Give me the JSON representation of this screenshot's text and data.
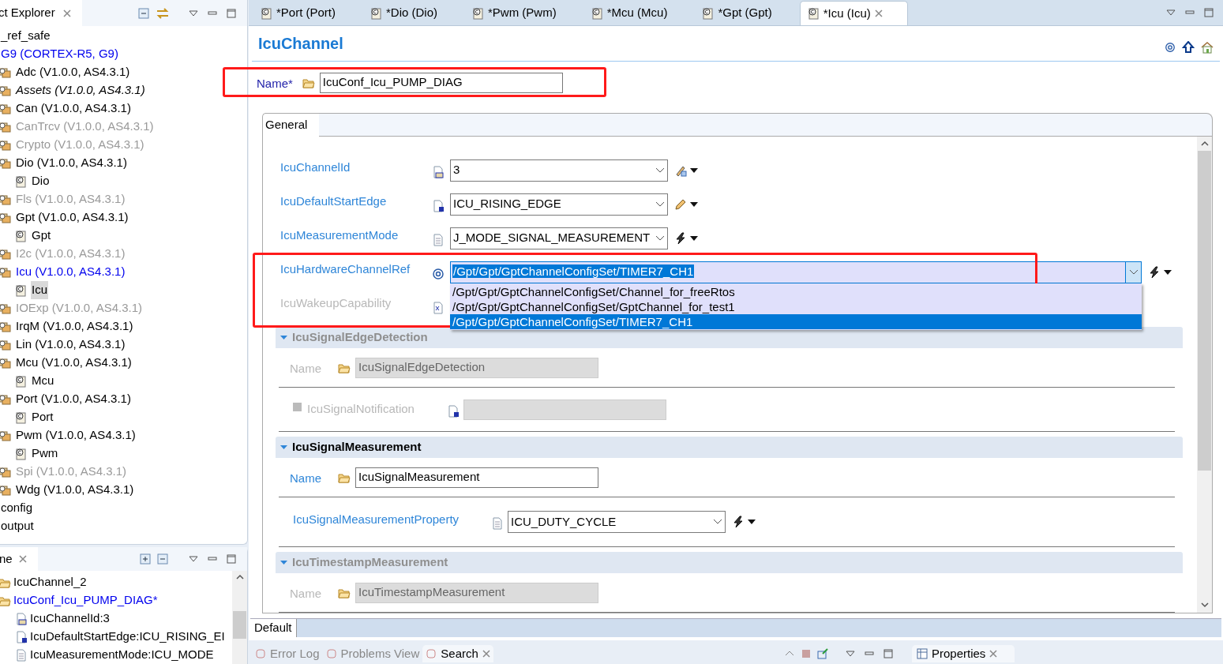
{
  "explorer": {
    "title": "ct Explorer",
    "items": [
      {
        "label": "_ref_safe",
        "kind": "normal",
        "selected": false
      },
      {
        "label": "G9 (CORTEX-R5, G9)",
        "kind": "active",
        "selected": false,
        "children": [
          {
            "label": "Adc (V1.0.0, AS4.3.1)",
            "kind": "normal",
            "selected": false
          },
          {
            "label": "Assets (V1.0.0, AS4.3.1)",
            "kind": "italic",
            "selected": false
          },
          {
            "label": "Can (V1.0.0, AS4.3.1)",
            "kind": "normal",
            "selected": false
          },
          {
            "label": "CanTrcv (V1.0.0, AS4.3.1)",
            "kind": "disabled",
            "selected": false
          },
          {
            "label": "Crypto (V1.0.0, AS4.3.1)",
            "kind": "disabled",
            "selected": false
          },
          {
            "label": "Dio (V1.0.0, AS4.3.1)",
            "kind": "normal",
            "selected": false,
            "children": [
              {
                "label": "Dio",
                "kind": "normal",
                "selected": false
              }
            ]
          },
          {
            "label": "Fls (V1.0.0, AS4.3.1)",
            "kind": "disabled",
            "selected": false
          },
          {
            "label": "Gpt (V1.0.0, AS4.3.1)",
            "kind": "normal",
            "selected": false,
            "children": [
              {
                "label": "Gpt",
                "kind": "normal",
                "selected": false
              }
            ]
          },
          {
            "label": "I2c (V1.0.0, AS4.3.1)",
            "kind": "disabled",
            "selected": false
          },
          {
            "label": "Icu (V1.0.0, AS4.3.1)",
            "kind": "active",
            "selected": false,
            "children": [
              {
                "label": "Icu",
                "kind": "normal",
                "selected": true
              }
            ]
          },
          {
            "label": "IOExp (V1.0.0, AS4.3.1)",
            "kind": "disabled",
            "selected": false
          },
          {
            "label": "IrqM (V1.0.0, AS4.3.1)",
            "kind": "normal",
            "selected": false
          },
          {
            "label": "Lin (V1.0.0, AS4.3.1)",
            "kind": "normal",
            "selected": false
          },
          {
            "label": "Mcu (V1.0.0, AS4.3.1)",
            "kind": "normal",
            "selected": false,
            "children": [
              {
                "label": "Mcu",
                "kind": "normal",
                "selected": false
              }
            ]
          },
          {
            "label": "Port (V1.0.0, AS4.3.1)",
            "kind": "normal",
            "selected": false,
            "children": [
              {
                "label": "Port",
                "kind": "normal",
                "selected": false
              }
            ]
          },
          {
            "label": "Pwm (V1.0.0, AS4.3.1)",
            "kind": "normal",
            "selected": false,
            "children": [
              {
                "label": "Pwm",
                "kind": "normal",
                "selected": false
              }
            ]
          },
          {
            "label": "Spi (V1.0.0, AS4.3.1)",
            "kind": "disabled",
            "selected": false
          },
          {
            "label": "Wdg (V1.0.0, AS4.3.1)",
            "kind": "normal",
            "selected": false
          }
        ]
      },
      {
        "label": "config",
        "kind": "normal",
        "selected": false
      },
      {
        "label": "output",
        "kind": "normal",
        "selected": false
      }
    ]
  },
  "outline": {
    "title": "ne",
    "items": [
      {
        "label": "IcuChannel_2",
        "kind": "container",
        "active": false
      },
      {
        "label": "IcuConf_Icu_PUMP_DIAG*",
        "kind": "container",
        "active": true,
        "children": [
          {
            "label": "IcuChannelId:3",
            "kind": "integer",
            "active": false
          },
          {
            "label": "IcuDefaultStartEdge:ICU_RISING_EI",
            "kind": "enum_d",
            "active": false
          },
          {
            "label": "IcuMeasurementMode:ICU_MODE",
            "kind": "enum",
            "active": false
          }
        ]
      }
    ]
  },
  "editor": {
    "tabs": [
      {
        "label": "*Port (Port)",
        "selected": false
      },
      {
        "label": "*Dio (Dio)",
        "selected": false
      },
      {
        "label": "*Pwm (Pwm)",
        "selected": false
      },
      {
        "label": "*Mcu (Mcu)",
        "selected": false
      },
      {
        "label": "*Gpt (Gpt)",
        "selected": false
      },
      {
        "label": "*Icu (Icu)",
        "selected": true
      }
    ],
    "title": "IcuChannel",
    "name": {
      "label": "Name*",
      "value": "IcuConf_Icu_PUMP_DIAG"
    },
    "form_tab": "General",
    "params": [
      {
        "label": "IcuChannelId",
        "kind": "integer",
        "value": "3",
        "disabled": false
      },
      {
        "label": "IcuDefaultStartEdge",
        "kind": "enum_d",
        "value": "ICU_RISING_EDGE",
        "disabled": false
      },
      {
        "label": "IcuMeasurementMode",
        "kind": "enum",
        "value": "J_MODE_SIGNAL_MEASUREMENT",
        "disabled": false
      },
      {
        "label": "IcuHardwareChannelRef",
        "kind": "reference",
        "value": "/Gpt/Gpt/GptChannelConfigSet/TIMER7_CH1",
        "disabled": false,
        "expanded": true,
        "options": [
          {
            "label": "/Gpt/Gpt/GptChannelConfigSet/Channel_for_freeRtos",
            "selected": false
          },
          {
            "label": "/Gpt/Gpt/GptChannelConfigSet/GptChannel_for_test1",
            "selected": false
          },
          {
            "label": "/Gpt/Gpt/GptChannelConfigSet/TIMER7_CH1",
            "selected": true
          }
        ]
      },
      {
        "label": "IcuWakeupCapability",
        "kind": "boolean",
        "disabled": true
      }
    ],
    "sections": [
      {
        "title": "IcuSignalEdgeDetection",
        "disabled": true,
        "expanded": true,
        "rows": [
          {
            "kind": "name",
            "label": "Name",
            "value": "IcuSignalEdgeDetection"
          },
          {
            "kind": "optional",
            "label": "IcuSignalNotification",
            "checked": false
          }
        ]
      },
      {
        "title": "IcuSignalMeasurement",
        "disabled": false,
        "expanded": true,
        "rows": [
          {
            "kind": "name",
            "label": "Name",
            "value": "IcuSignalMeasurement"
          },
          {
            "kind": "enum",
            "label": "IcuSignalMeasurementProperty",
            "value": "ICU_DUTY_CYCLE"
          }
        ]
      },
      {
        "title": "IcuTimestampMeasurement",
        "disabled": true,
        "expanded": true,
        "rows": [
          {
            "kind": "name",
            "label": "Name",
            "value": "IcuTimestampMeasurement"
          }
        ]
      }
    ],
    "page_tab": "Default"
  },
  "bottom": {
    "tabs": [
      {
        "label": "Error Log",
        "selected": false
      },
      {
        "label": "Problems View",
        "selected": false
      },
      {
        "label": "Search",
        "selected": true
      }
    ],
    "side_tab": "Properties"
  }
}
